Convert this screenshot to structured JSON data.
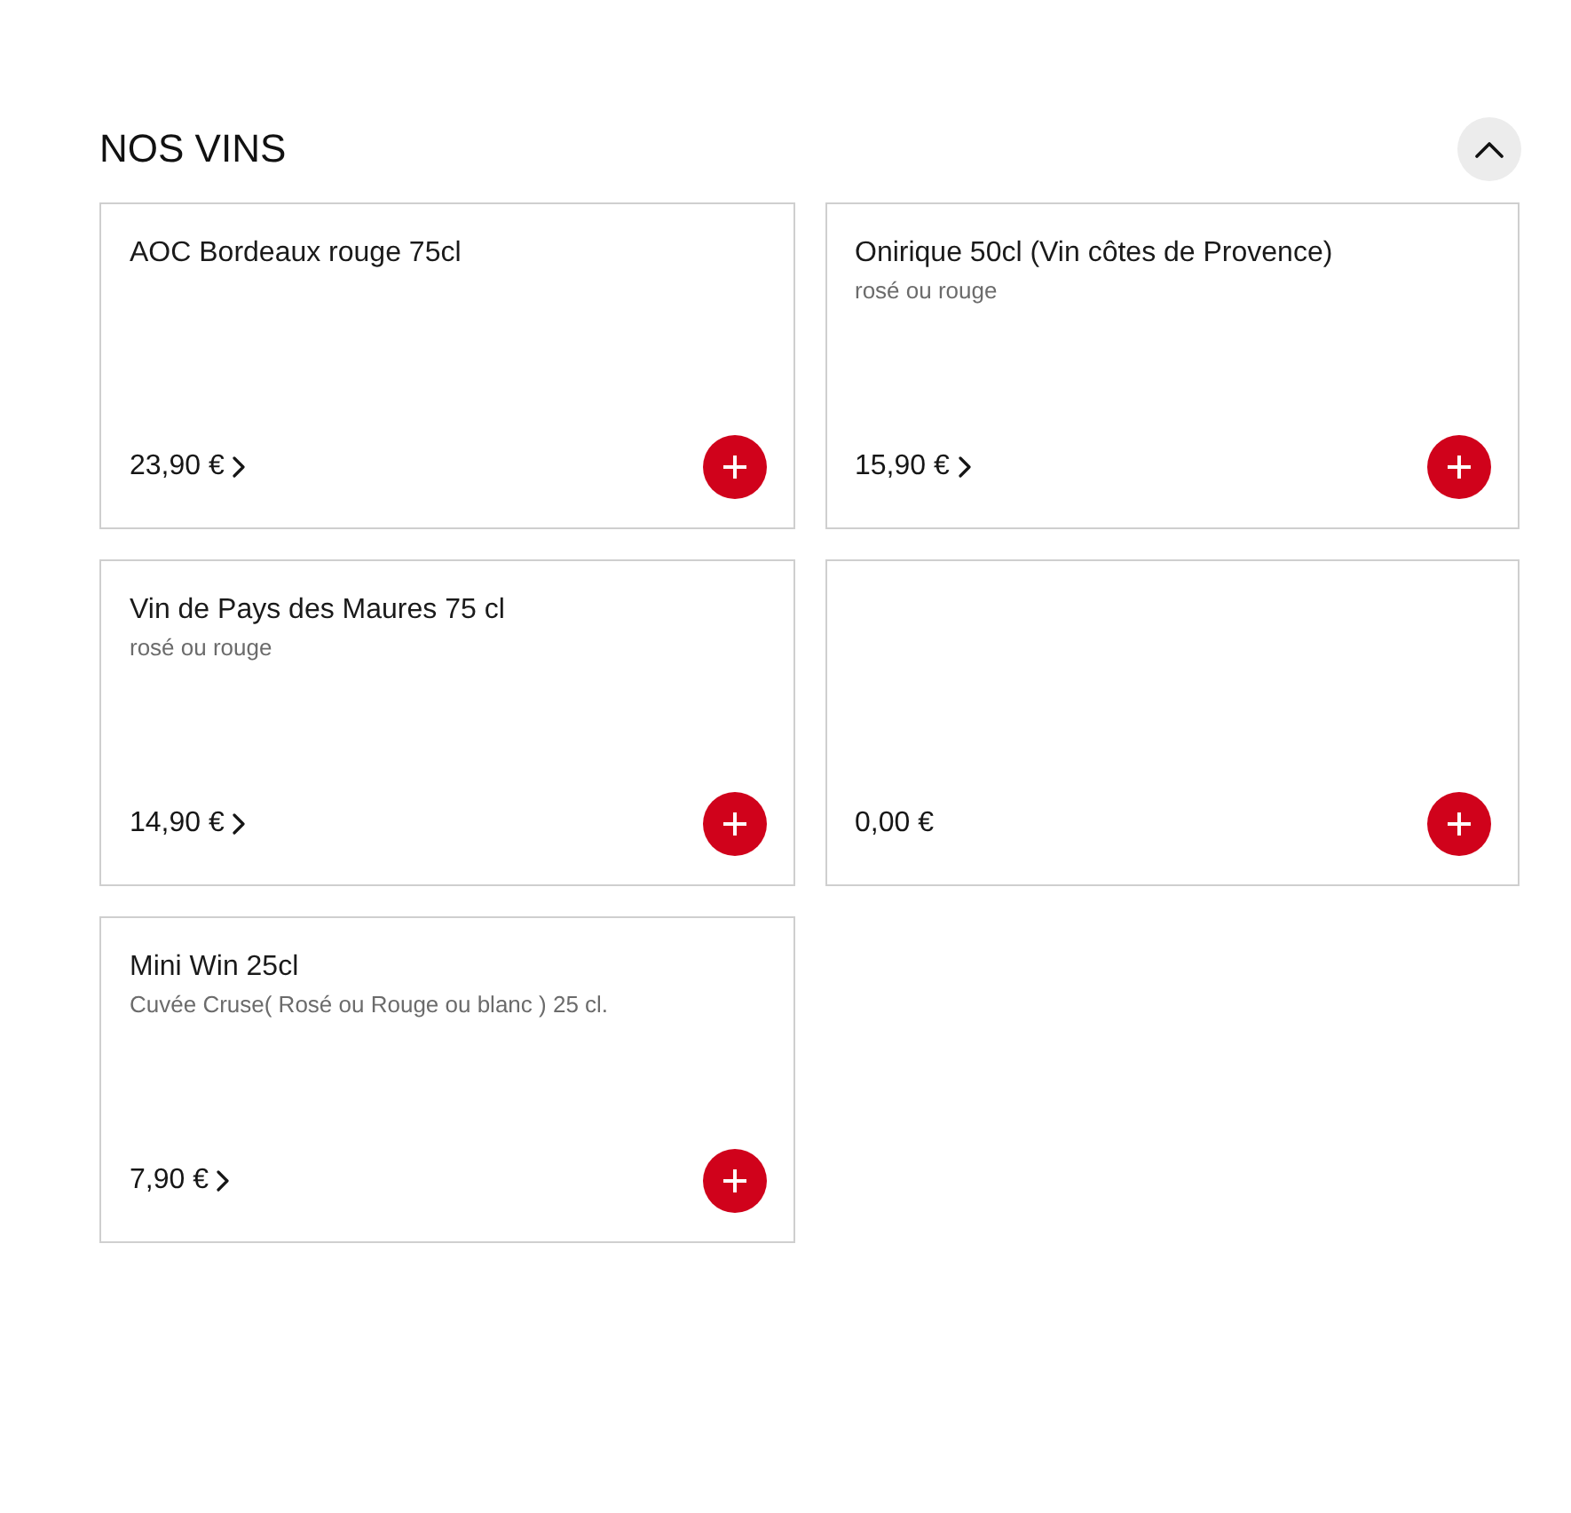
{
  "section": {
    "title": "NOS VINS",
    "expanded": true
  },
  "products": [
    {
      "name": "AOC Bordeaux rouge 75cl",
      "price": "23,90 €",
      "details": true
    },
    {
      "name": "Onirique 50cl (Vin côtes de Provence)",
      "description": "rosé ou rouge",
      "price": "15,90 €",
      "details": true
    },
    {
      "name": "Vin de Pays des Maures 75 cl",
      "description": "rosé ou rouge",
      "price": "14,90 €",
      "details": true
    },
    {
      "price": "0,00 €",
      "details": false
    },
    {
      "name": "Mini Win 25cl",
      "description": "Cuvée Cruse( Rosé ou Rouge ou blanc ) 25 cl.",
      "price": "7,90 €",
      "details": true
    }
  ]
}
